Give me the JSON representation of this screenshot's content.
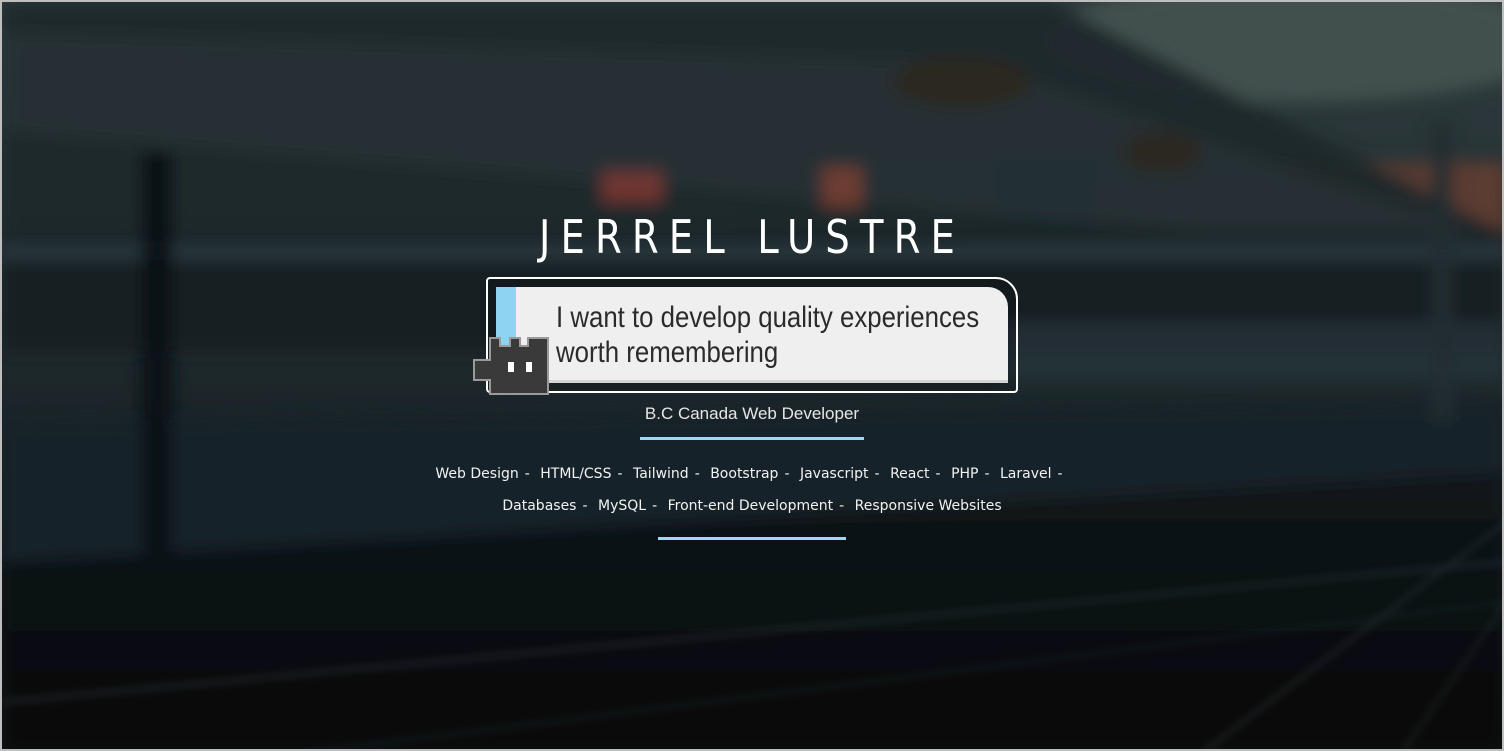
{
  "hero": {
    "name": "JERREL LUSTRE",
    "tagline_line1": "I want to develop quality experiences",
    "tagline_line2": "worth remembering",
    "subtitle": "B.C Canada Web Developer",
    "separator": "-",
    "skills_row1": [
      "Web Design",
      "HTML/CSS",
      "Tailwind",
      "Bootstrap",
      "Javascript",
      "React",
      "PHP",
      "Laravel"
    ],
    "skills_row2": [
      "Databases",
      "MySQL",
      "Front-end Development",
      "Responsive Websites"
    ]
  },
  "colors": {
    "accent": "#9fd6f5",
    "card": "#efefef",
    "text_light": "#ffffff",
    "text_dark": "#2b2b2b"
  },
  "icons": {
    "mascot": "pixel-robot-icon"
  }
}
